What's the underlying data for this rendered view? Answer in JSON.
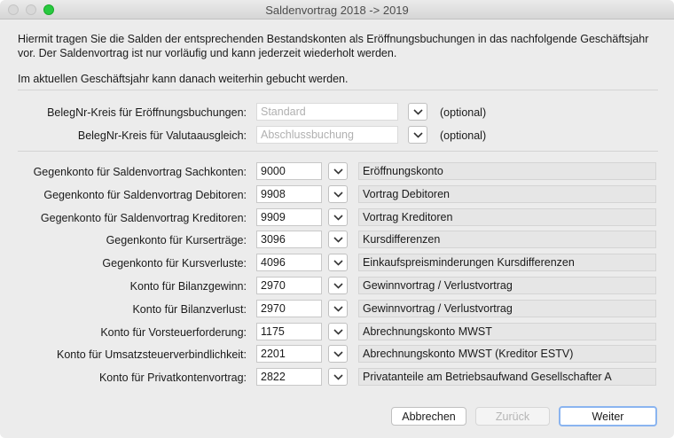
{
  "window": {
    "title": "Saldenvortrag 2018 -> 2019"
  },
  "intro": {
    "line1": "Hiermit tragen Sie die Salden der entsprechenden Bestandskonten als Eröffnungsbuchungen in das nachfolgende Geschäftsjahr",
    "line2": "vor. Der Saldenvortrag ist nur vorläufig und kann jederzeit wiederholt werden.",
    "line3": "Im aktuellen Geschäftsjahr kann danach weiterhin gebucht werden."
  },
  "beleg": [
    {
      "label": "BelegNr-Kreis für Eröffnungsbuchungen:",
      "value": "Standard",
      "optional": "(optional)"
    },
    {
      "label": "BelegNr-Kreis für Valutaausgleich:",
      "value": "Abschlussbuchung",
      "optional": "(optional)"
    }
  ],
  "accounts": [
    {
      "label": "Gegenkonto für Saldenvortrag Sachkonten:",
      "number": "9000",
      "description": "Eröffnungskonto"
    },
    {
      "label": "Gegenkonto für Saldenvortrag Debitoren:",
      "number": "9908",
      "description": "Vortrag Debitoren"
    },
    {
      "label": "Gegenkonto für Saldenvortrag Kreditoren:",
      "number": "9909",
      "description": "Vortrag Kreditoren"
    },
    {
      "label": "Gegenkonto für Kurserträge:",
      "number": "3096",
      "description": "Kursdifferenzen"
    },
    {
      "label": "Gegenkonto für Kursverluste:",
      "number": "4096",
      "description": "Einkaufspreisminderungen Kursdifferenzen"
    },
    {
      "label": "Konto für Bilanzgewinn:",
      "number": "2970",
      "description": "Gewinnvortrag / Verlustvortrag"
    },
    {
      "label": "Konto für Bilanzverlust:",
      "number": "2970",
      "description": "Gewinnvortrag / Verlustvortrag"
    },
    {
      "label": "Konto für Vorsteuerforderung:",
      "number": "1175",
      "description": "Abrechnungskonto MWST"
    },
    {
      "label": "Konto für Umsatzsteuerverbindlichkeit:",
      "number": "2201",
      "description": "Abrechnungskonto MWST (Kreditor ESTV)"
    },
    {
      "label": "Konto für Privatkontenvortrag:",
      "number": "2822",
      "description": "Privatanteile am Betriebsaufwand Gesellschafter A"
    }
  ],
  "buttons": {
    "cancel": "Abbrechen",
    "back": "Zurück",
    "next": "Weiter"
  },
  "icons": {
    "dropdown": "chevron-down-icon"
  },
  "colors": {
    "zoom": "#28c940",
    "default_button_ring": "#8ab4f0"
  }
}
